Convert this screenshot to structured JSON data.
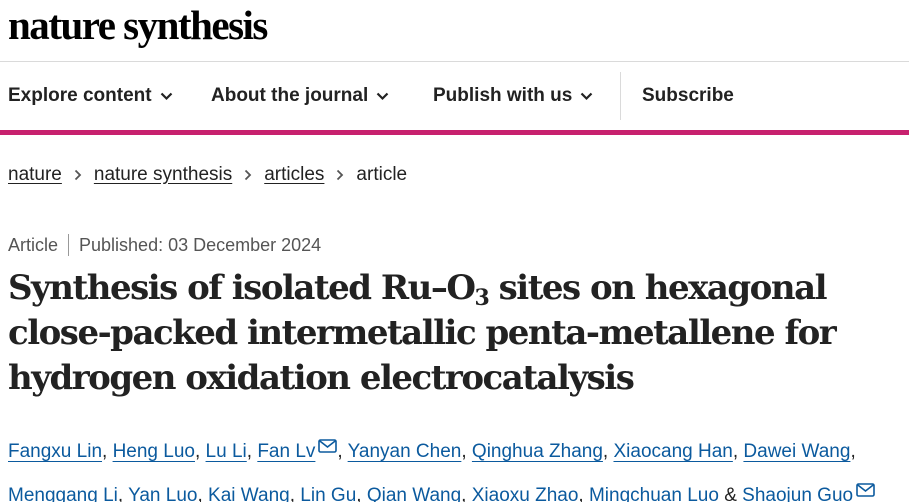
{
  "site": {
    "logo": "nature synthesis"
  },
  "nav": {
    "items": [
      {
        "label": "Explore content"
      },
      {
        "label": "About the journal"
      },
      {
        "label": "Publish with us"
      }
    ],
    "subscribe": "Subscribe"
  },
  "breadcrumb": {
    "items": [
      "nature",
      "nature synthesis",
      "articles"
    ],
    "current": "article"
  },
  "article": {
    "type": "Article",
    "published": "Published: 03 December 2024",
    "title_parts": [
      "Synthesis of isolated Ru–O",
      "3",
      " sites on hexagonal close-packed intermetallic penta-metallene for hydrogen oxidation electrocatalysis"
    ],
    "authors": [
      "Fangxu Lin",
      "Heng Luo",
      "Lu Li",
      "Fan Lv",
      "Yanyan Chen",
      "Qinghua Zhang",
      "Xiaocang Han",
      "Dawei Wang",
      "Menggang Li",
      "Yan Luo",
      "Kai Wang",
      "Lin Gu",
      "Qian Wang",
      "Xiaoxu Zhao",
      "Mingchuan Luo",
      "Shaojun Guo"
    ],
    "author_separator": ", ",
    "last_author_separator": " & "
  },
  "colors": {
    "accent": "#c7216e",
    "link": "#0b5a9e",
    "text": "#222222",
    "meta": "#555555"
  },
  "icons": {
    "nav_chevron": "chevron-down-icon",
    "breadcrumb_sep": "chevron-right-icon",
    "corresponding": "mail-icon"
  }
}
